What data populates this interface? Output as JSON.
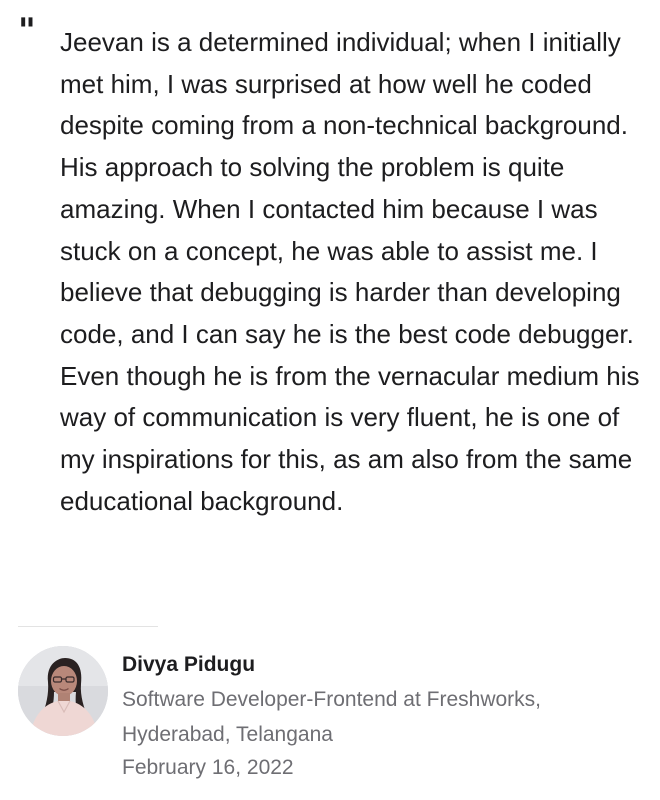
{
  "testimonial": {
    "quote": "Jeevan is a determined individual; when I initially met him, I was surprised at how well he coded despite coming from a non-technical background. His approach to solving the problem is quite amazing. When I contacted him because I was stuck on a concept, he was able to assist me. I believe that debugging is harder than developing code, and I can say he is the best code debugger. Even though he is from the vernacular medium his way of communication is very fluent, he is one of my inspirations for this, as am also from the same educational background.",
    "quote_icon": "quote-icon",
    "author": {
      "name": "Divya Pidugu",
      "role": "Software Developer-Frontend at Freshworks, Hyderabad, Telangana",
      "avatar_icon": "avatar-photo"
    },
    "date": "February 16, 2022"
  },
  "colors": {
    "text_primary": "#1d1d1f",
    "text_secondary": "#6e6e73",
    "divider": "#e3e3e3",
    "background": "#ffffff"
  }
}
